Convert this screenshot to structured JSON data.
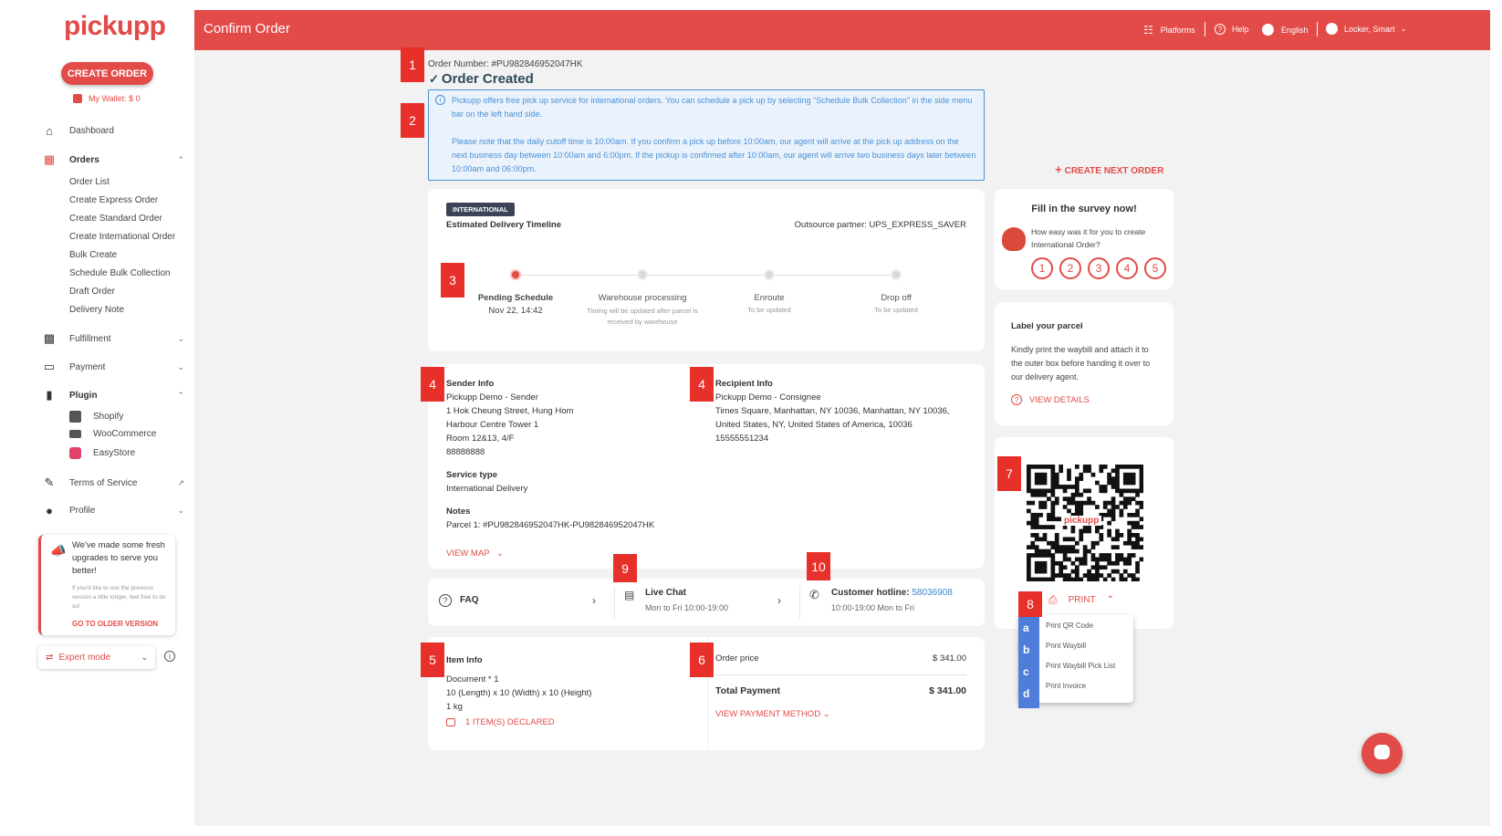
{
  "sidebar": {
    "logo": "pickupp",
    "create_order": "CREATE ORDER",
    "wallet": "My Wallet: $ 0",
    "dashboard": "Dashboard",
    "orders": "Orders",
    "order_sub": [
      "Order List",
      "Create Express Order",
      "Create Standard Order",
      "Create International Order",
      "Bulk Create",
      "Schedule Bulk Collection",
      "Draft Order",
      "Delivery Note"
    ],
    "fulfillment": "Fulfillment",
    "payment": "Payment",
    "plugin": "Plugin",
    "plugin_sub": [
      "Shopify",
      "WooCommerce",
      "EasyStore"
    ],
    "terms": "Terms of Service",
    "profile": "Profile",
    "upgrade_title": "We've made some fresh upgrades to serve you better!",
    "upgrade_desc": "If you'd like to use the previous version a little longer, feel free to do so!",
    "upgrade_link": "GO TO OLDER VERSION",
    "expert_mode": "Expert mode"
  },
  "topbar": {
    "title": "Confirm Order",
    "platforms": "Platforms",
    "help": "Help",
    "language": "English",
    "user": "Locker, Smart"
  },
  "order": {
    "number": "Order Number: #PU982846952047HK",
    "status": "Order Created"
  },
  "info": {
    "p1": "Pickupp offers free pick up service for international orders. You can schedule a pick up by selecting \"Schedule Bulk Collection\" in the side menu bar on the left hand side.",
    "p2": "Please note that the daily cutoff time is 10:00am. If you confirm a pick up before 10:00am, our agent will arrive at the pick up address on the next business day between 10:00am and 6:00pm. If the pickup is confirmed after 10:00am, our agent will arrive two business days later between 10:00am and 06:00pm."
  },
  "create_next": "CREATE NEXT ORDER",
  "timeline": {
    "tag": "INTERNATIONAL",
    "title": "Estimated Delivery Timeline",
    "partner": "Outsource partner: UPS_EXPRESS_SAVER",
    "steps": [
      {
        "name": "Pending Schedule",
        "detail": "Nov 22, 14:42"
      },
      {
        "name": "Warehouse processing",
        "detail": "Timing will be updated after parcel is received by warehouse"
      },
      {
        "name": "Enroute",
        "detail": "To be updated"
      },
      {
        "name": "Drop off",
        "detail": "To be updated"
      }
    ],
    "completed_steps": 1
  },
  "sender": {
    "title": "Sender Info",
    "lines": [
      "Pickupp Demo - Sender",
      "1 Hok Cheung Street, Hung Hom",
      "Harbour Centre Tower 1",
      "Room 12&13, 4/F",
      "88888888"
    ]
  },
  "recipient": {
    "title": "Recipient Info",
    "lines": [
      "Pickupp Demo - Consignee",
      "Times Square, Manhattan, NY 10036, Manhattan, NY 10036,",
      "United States, NY, United States of America, 10036",
      "15555551234"
    ]
  },
  "service": {
    "title": "Service type",
    "value": "International Delivery"
  },
  "notes": {
    "title": "Notes",
    "value": "Parcel 1: #PU982846952047HK-PU982846952047HK"
  },
  "view_map": "VIEW MAP",
  "support": {
    "faq": "FAQ",
    "chat_title": "Live Chat",
    "chat_hours": "Mon to Fri 10:00-19:00",
    "hotline_label": "Customer hotline:",
    "hotline_number": "58036908",
    "hotline_hours": "10:00-19:00 Mon to Fri"
  },
  "item": {
    "title": "Item Info",
    "lines": [
      "Document * 1",
      "10 (Length) x 10 (Width) x 10 (Height)",
      "1 kg"
    ],
    "declared": "1 ITEM(S) DECLARED"
  },
  "price": {
    "order_label": "Order price",
    "order_value": "$ 341.00",
    "total_label": "Total Payment",
    "total_value": "$ 341.00",
    "method": "VIEW PAYMENT METHOD"
  },
  "survey": {
    "title": "Fill in the survey now!",
    "question": "How easy was it for you to create International Order?",
    "ratings": [
      "1",
      "2",
      "3",
      "4",
      "5"
    ]
  },
  "label": {
    "title": "Label your parcel",
    "desc": "Kindly print the waybill and attach it to the outer box before handing it over to our delivery agent.",
    "link": "VIEW DETAILS"
  },
  "qr": {
    "brand": "pickupp"
  },
  "print": {
    "label": "PRINT",
    "options": [
      "Print QR Code",
      "Print Waybill",
      "Print Waybill Pick List",
      "Print Invoice"
    ],
    "letters": [
      "a",
      "b",
      "c",
      "d"
    ]
  },
  "badges": [
    "1",
    "2",
    "3",
    "4",
    "4",
    "5",
    "6",
    "7",
    "8",
    "9",
    "10"
  ],
  "colors": {
    "brand": "#e24b48",
    "badge": "#e8302a",
    "info": "#4a8fd6",
    "info_bg": "#eaf3fc",
    "letters": "#4f7dd9"
  }
}
